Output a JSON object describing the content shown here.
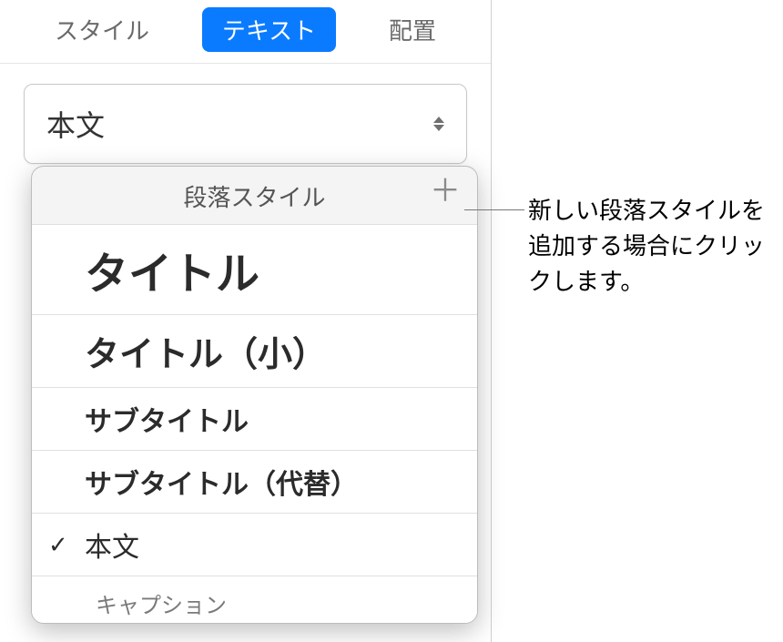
{
  "tabs": {
    "style": "スタイル",
    "text": "テキスト",
    "arrange": "配置"
  },
  "dropdown": {
    "value": "本文"
  },
  "popover": {
    "title": "段落スタイル",
    "items": {
      "title": "タイトル",
      "title_small": "タイトル（小）",
      "subtitle": "サブタイトル",
      "subtitle_alt": "サブタイトル（代替）",
      "body": "本文",
      "caption": "キャプション"
    }
  },
  "callout": {
    "text": "新しい段落スタイルを追加する場合にクリックします。"
  }
}
